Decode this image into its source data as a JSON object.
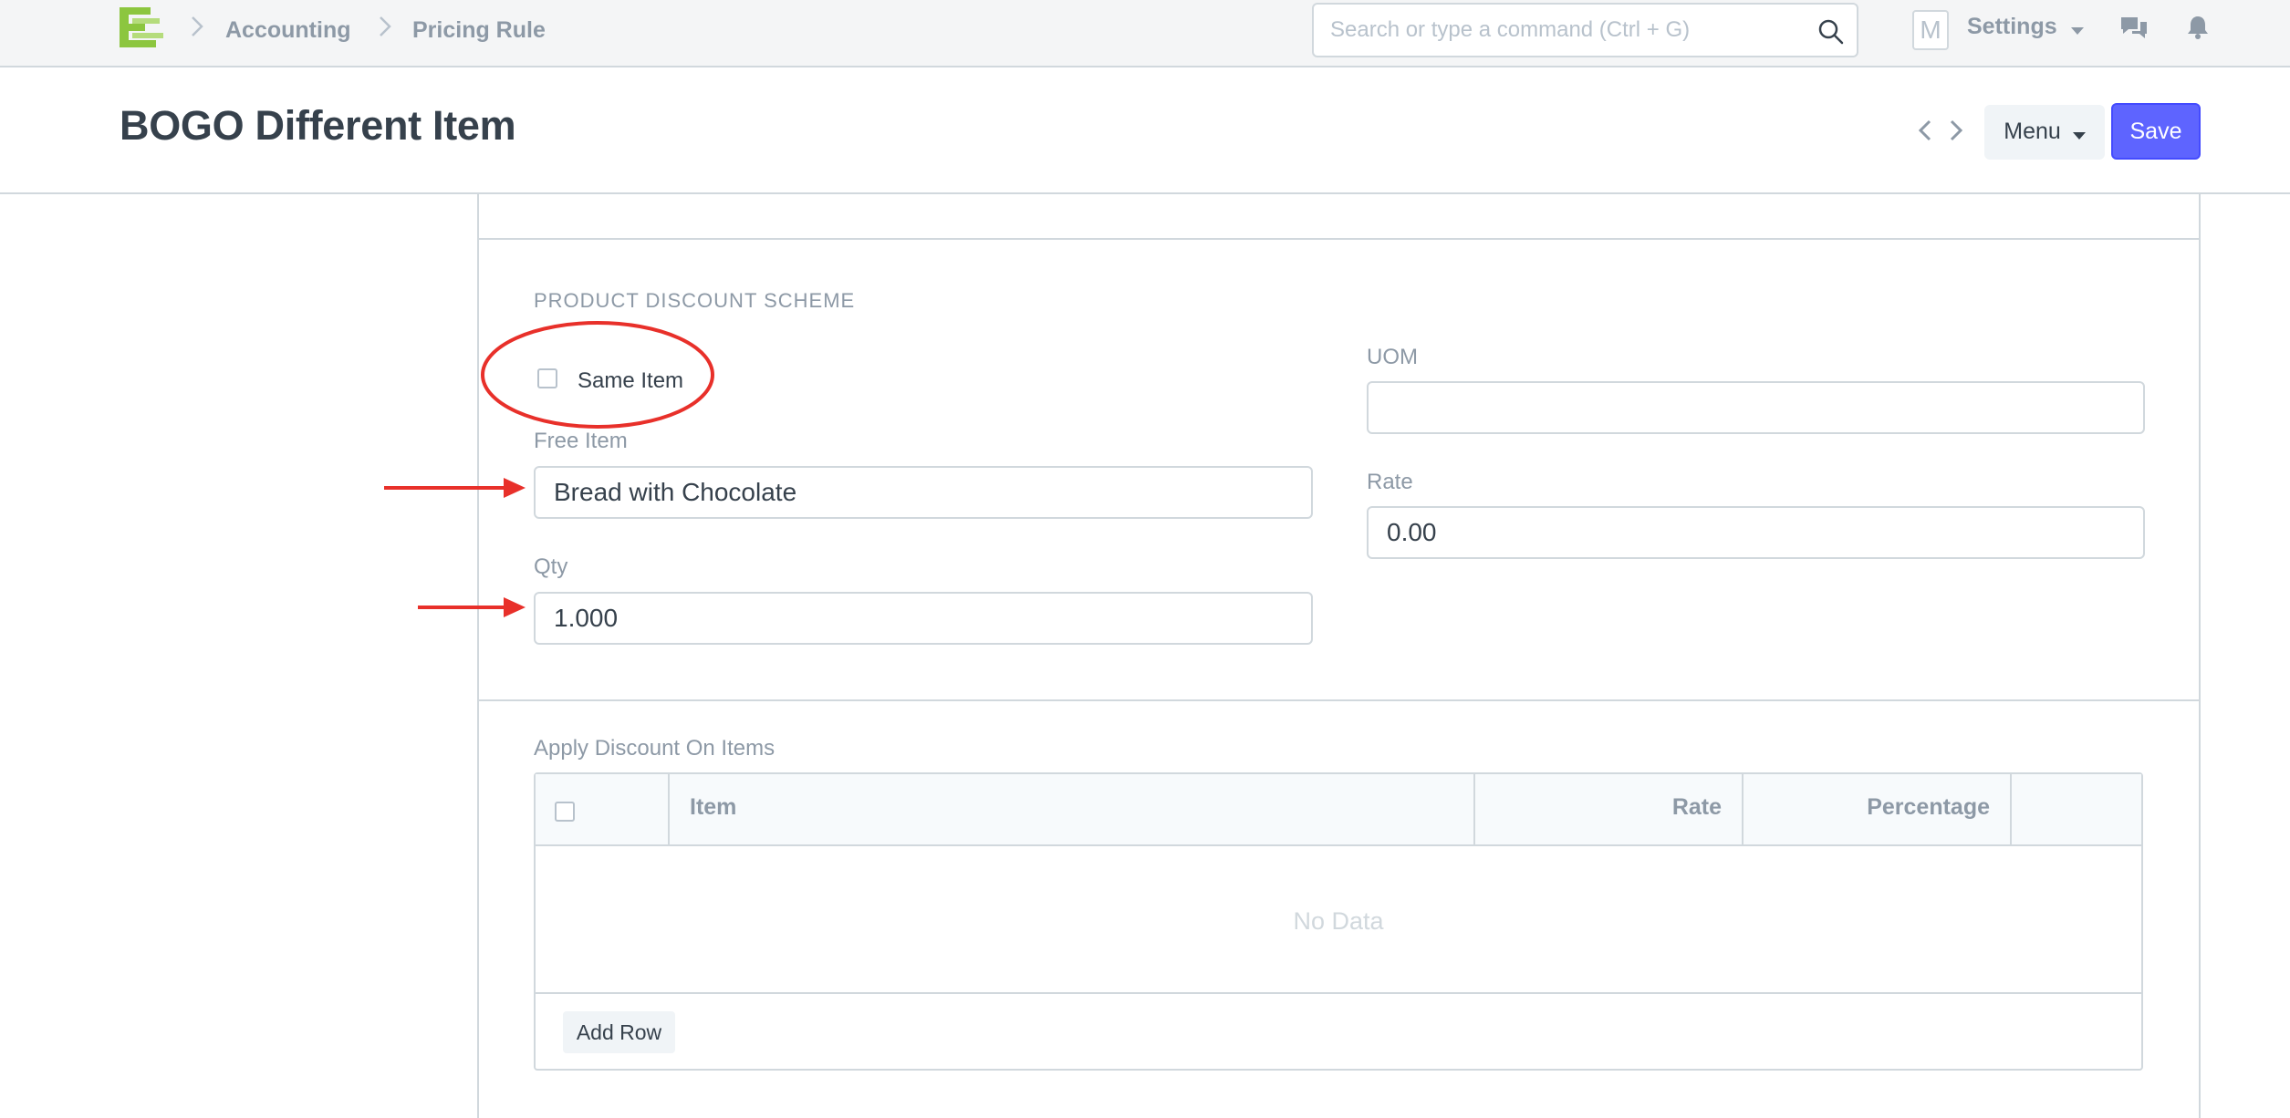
{
  "navbar": {
    "breadcrumbs": [
      {
        "label": "Accounting"
      },
      {
        "label": "Pricing Rule"
      }
    ],
    "search_placeholder": "Search or type a command (Ctrl + G)",
    "avatar_letter": "M",
    "settings_label": "Settings"
  },
  "page_head": {
    "title": "BOGO Different Item",
    "menu_label": "Menu",
    "save_label": "Save"
  },
  "section": {
    "heading": "PRODUCT DISCOUNT SCHEME",
    "same_item_label": "Same Item",
    "free_item_label": "Free Item",
    "free_item_value": "Bread with Chocolate",
    "qty_label": "Qty",
    "qty_value": "1.000",
    "uom_label": "UOM",
    "uom_value": "",
    "rate_label": "Rate",
    "rate_value": "0.00"
  },
  "discount_items": {
    "label": "Apply Discount On Items",
    "columns": [
      "Item",
      "Rate",
      "Percentage"
    ],
    "empty_text": "No Data",
    "add_row_label": "Add Row"
  },
  "colors": {
    "primary": "#5e64ff",
    "annotation_red": "#e8302a",
    "logo_green": "#8cc63f"
  }
}
